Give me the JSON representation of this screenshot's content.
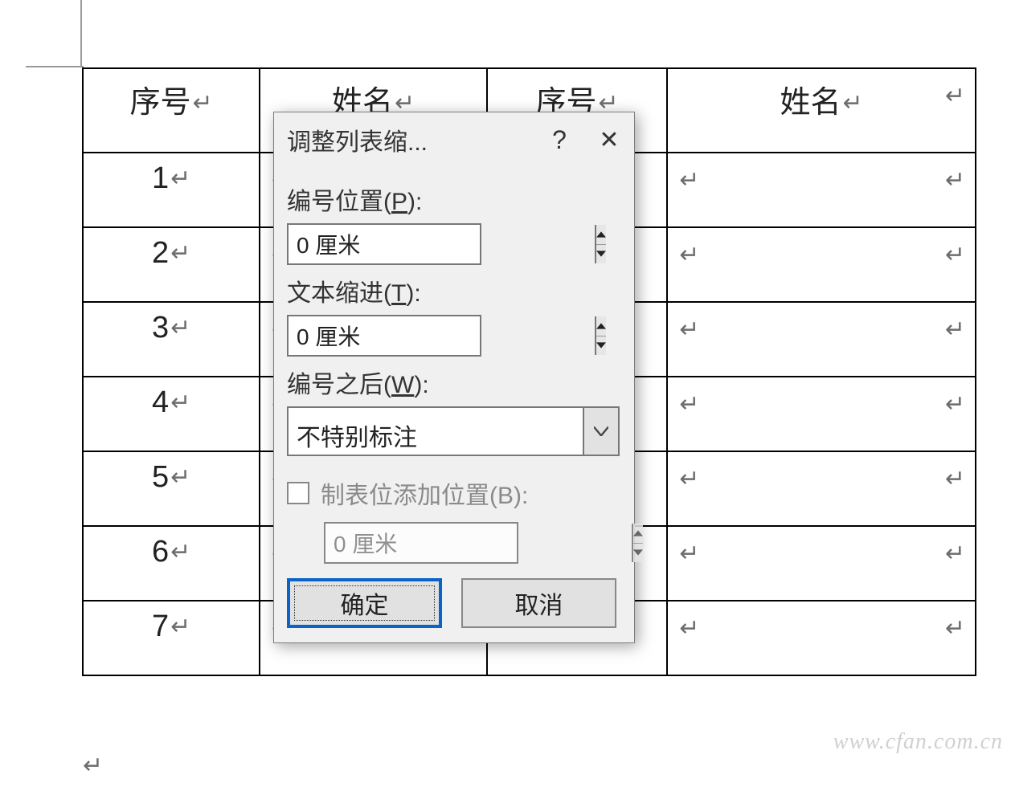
{
  "table": {
    "headers": [
      "序号",
      "姓名",
      "序号",
      "姓名"
    ],
    "rows": [
      {
        "n": "1"
      },
      {
        "n": "2"
      },
      {
        "n": "3"
      },
      {
        "n": "4"
      },
      {
        "n": "5"
      },
      {
        "n": "6"
      },
      {
        "n": "7"
      }
    ]
  },
  "dialog": {
    "title": "调整列表缩...",
    "help": "?",
    "close": "✕",
    "number_position_label_pre": "编号位置(",
    "number_position_label_key": "P",
    "number_position_label_post": "):",
    "number_position_value": "0 厘米",
    "text_indent_label_pre": "文本缩进(",
    "text_indent_label_key": "T",
    "text_indent_label_post": "):",
    "text_indent_value": "0 厘米",
    "after_number_label_pre": "编号之后(",
    "after_number_label_key": "W",
    "after_number_label_post": "):",
    "after_number_value": "不特别标注",
    "tabstop_label": "制表位添加位置(B):",
    "tabstop_value": "0 厘米",
    "ok": "确定",
    "cancel": "取消"
  },
  "watermark": "www.cfan.com.cn",
  "glyph": {
    "paragraph": "↵"
  }
}
